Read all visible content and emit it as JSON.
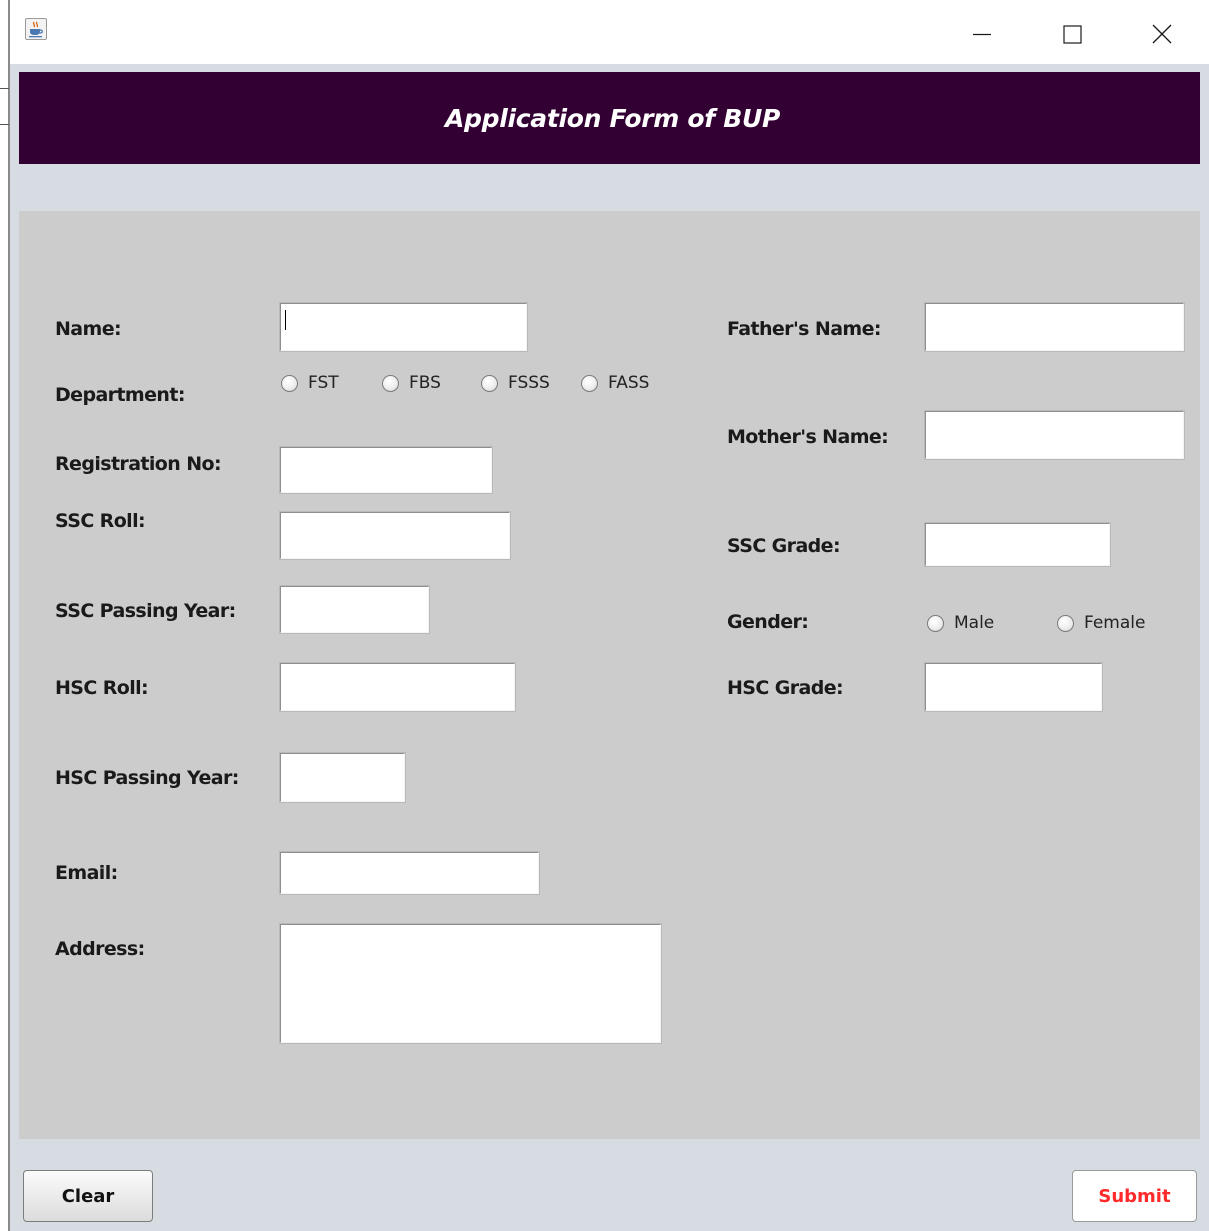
{
  "window": {
    "icon": "java-cup-icon",
    "controls": [
      "minimize-icon",
      "maximize-icon",
      "close-icon"
    ]
  },
  "header": {
    "title": "Application Form of BUP",
    "background": "#330033"
  },
  "form": {
    "name_label": "Name:",
    "department_label": "Department:",
    "departments": [
      "FST",
      "FBS",
      "FSSS",
      "FASS"
    ],
    "registration_label": "Registration No:",
    "ssc_roll_label": "SSC Roll:",
    "ssc_year_label": "SSC Passing Year:",
    "hsc_roll_label": "HSC Roll:",
    "hsc_year_label": "HSC Passing Year:",
    "email_label": "Email:",
    "address_label": "Address:",
    "father_label": "Father's Name:",
    "mother_label": "Mother's Name:",
    "ssc_grade_label": "SSC Grade:",
    "gender_label": "Gender:",
    "genders": [
      "Male",
      "Female"
    ],
    "hsc_grade_label": "HSC Grade:"
  },
  "buttons": {
    "clear_label": "Clear",
    "submit_label": "Submit",
    "submit_color": "#ff2a2a"
  }
}
